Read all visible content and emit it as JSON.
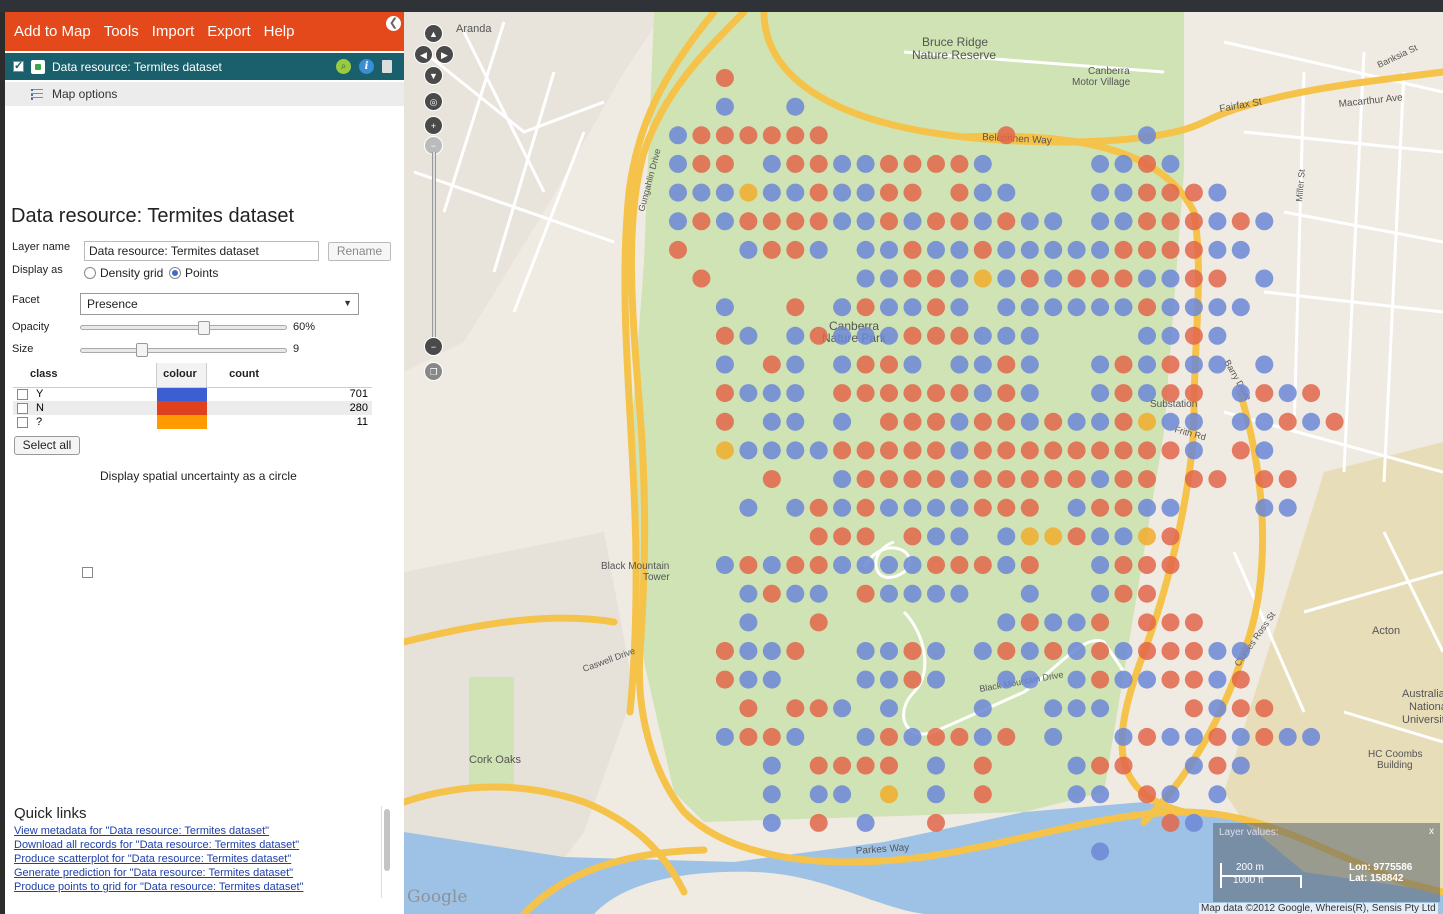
{
  "menu": [
    "Add to Map",
    "Tools",
    "Import",
    "Export",
    "Help"
  ],
  "layer": {
    "row_label": "Data resource: Termites dataset",
    "map_options": "Map options",
    "title": "Data resource: Termites dataset",
    "layer_name_label": "Layer name",
    "layer_name_value": "Data resource: Termites dataset",
    "rename_label": "Rename",
    "display_as_label": "Display as",
    "display_density": "Density grid",
    "display_points": "Points",
    "facet_label": "Facet",
    "facet_value": "Presence",
    "opacity_label": "Opacity",
    "opacity_value": "60%",
    "opacity_fraction": 0.6,
    "size_label": "Size",
    "size_value": "9",
    "size_fraction": 0.3
  },
  "legend": {
    "headers": [
      "class",
      "colour",
      "count"
    ],
    "rows": [
      {
        "class": "Y",
        "colour": "#3b5ed3",
        "count": "701"
      },
      {
        "class": "N",
        "colour": "#e0401b",
        "count": "280"
      },
      {
        "class": "?",
        "colour": "#ff9b00",
        "count": "11"
      }
    ]
  },
  "select_all": "Select all",
  "uncertainty_label": "Display spatial uncertainty as a circle",
  "quick_links": {
    "title": "Quick links",
    "links": [
      "View metadata for \"Data resource: Termites dataset\"",
      "Download all records for \"Data resource: Termites dataset\"",
      "Produce scatterplot for \"Data resource: Termites dataset\"",
      "Generate prediction for \"Data resource: Termites dataset\"",
      "Produce points to grid for \"Data resource: Termites dataset\""
    ]
  },
  "map": {
    "labels": {
      "aranda": "Aranda",
      "bruce_ridge": "Bruce Ridge",
      "nature_reserve": "Nature Reserve",
      "canberra_mv1": "Canberra",
      "canberra_mv2": "Motor Village",
      "cnp1": "Canberra",
      "cnp2": "Nature Park",
      "bm_tower1": "Black Mountain",
      "bm_tower2": "Tower",
      "cork_oaks": "Cork Oaks",
      "substation": "Substation",
      "acton": "Acton",
      "anu1": "Australian",
      "anu2": "National",
      "anu3": "University",
      "hc1": "HC Coombs",
      "hc2": "Building",
      "belconnen_way": "Belconnen Way",
      "fairfax": "Fairfax St",
      "macarthur": "Macarthur Ave",
      "parkes_way": "Parkes Way",
      "caswell": "Caswell Drive",
      "gungahlin": "Gungahlin Drive",
      "barry": "Barry Drive",
      "clunies": "Clunies Ross St",
      "frith": "Frith Rd",
      "bm_drive": "Black Mountain Drive",
      "banksia": "Banksia St",
      "miller": "Miller St"
    },
    "layer_values_label": "Layer values:",
    "layer_values_close": "x",
    "scale_m": "200 m",
    "scale_ft": "1000 ft",
    "lon": "Lon: 9775586",
    "lat": "Lat: 158842",
    "attribution": "Map data ©2012 Google, Whereis(R), Sensis Pty Ltd",
    "google": "Google",
    "colors": {
      "Y": "#6b87d6",
      "N": "#e2664a",
      "Q": "#f0ad2b",
      "park": "#cfe3b4",
      "road": "#f6c34a"
    }
  }
}
